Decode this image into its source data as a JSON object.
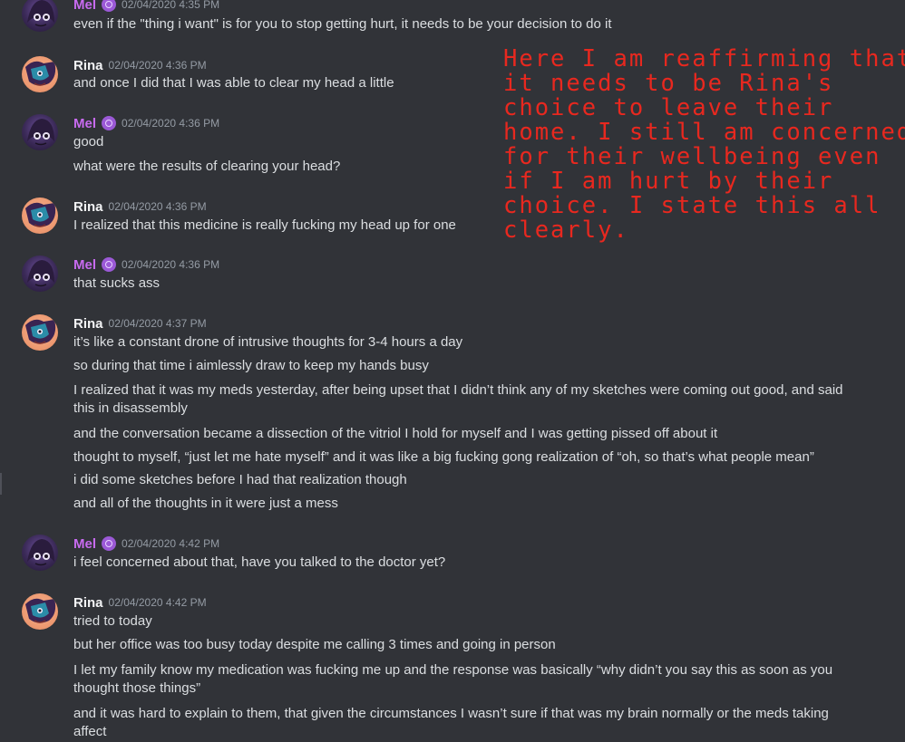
{
  "messages": [
    {
      "author": "Mel",
      "timestamp": "02/04/2020 4:35 PM",
      "lines": [
        "even if the \"thing i want\" is for you to stop getting hurt, it needs to be your decision to do it"
      ]
    },
    {
      "author": "Rina",
      "timestamp": "02/04/2020 4:36 PM",
      "lines": [
        "and once I did that I was able to clear my head a little"
      ]
    },
    {
      "author": "Mel",
      "timestamp": "02/04/2020 4:36 PM",
      "lines": [
        "good",
        "what were the results of clearing your head?"
      ]
    },
    {
      "author": "Rina",
      "timestamp": "02/04/2020 4:36 PM",
      "lines": [
        "I realized that this medicine is really fucking my head up for one"
      ]
    },
    {
      "author": "Mel",
      "timestamp": "02/04/2020 4:36 PM",
      "lines": [
        "that sucks ass"
      ]
    },
    {
      "author": "Rina",
      "timestamp": "02/04/2020 4:37 PM",
      "lines": [
        "it’s like a constant drone of intrusive thoughts for 3-4 hours a day",
        "so during that time i aimlessly draw to keep my hands busy",
        "I realized that it was my meds yesterday, after being upset that I didn’t think any of my sketches were coming out good, and said this in disassembly",
        "and the conversation became a dissection of the vitriol I hold for myself and I was getting pissed off about it",
        "thought to myself, “just let me hate myself” and it was like a big fucking gong realization of “oh, so that’s what people mean”",
        "i did some sketches before I had that realization though",
        "and all of the thoughts in it were just a mess"
      ]
    },
    {
      "author": "Mel",
      "timestamp": "02/04/2020 4:42 PM",
      "lines": [
        "i feel concerned about that, have you talked to the doctor yet?"
      ]
    },
    {
      "author": "Rina",
      "timestamp": "02/04/2020 4:42 PM",
      "lines": [
        "tried to today",
        "but her office was too busy today despite me calling 3 times and going in person",
        "I let my family know my medication was fucking me up and the response was basically “why didn’t you say this as soon as you thought those things”",
        "and it was hard to explain to them, that given the circumstances I wasn’t sure if that was my brain normally or the meds taking affect"
      ]
    }
  ],
  "annotation": {
    "lines": [
      "Here I am reaffirming that",
      "it needs to be Rina's",
      "choice to leave their",
      "home. I still am concerned",
      "for their wellbeing even",
      "if I am hurt by their",
      "choice. I state this all",
      "clearly."
    ],
    "color": "#e8281f"
  },
  "colors": {
    "background": "#313338",
    "mel": "#c86bf0",
    "rina": "#f2f3f5",
    "timestamp": "#949ba4",
    "text": "#dbdee1"
  }
}
